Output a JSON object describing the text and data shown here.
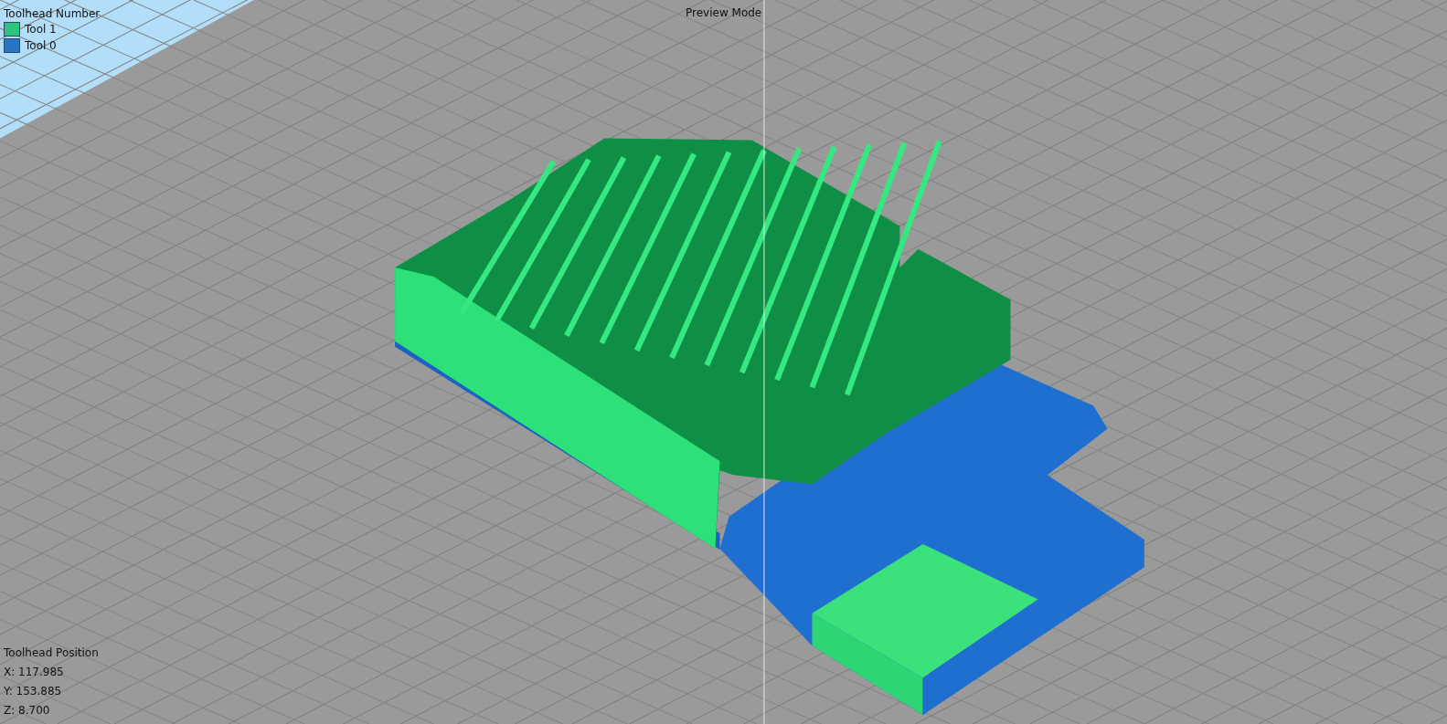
{
  "legend": {
    "title": "Toolhead Number",
    "items": [
      {
        "label": "Tool 1",
        "color": "#2ec47e"
      },
      {
        "label": "Tool 0",
        "color": "#2a74c6"
      }
    ]
  },
  "mode_label": "Preview Mode",
  "position": {
    "title": "Toolhead Position",
    "lines": [
      "X: 117.985",
      "Y: 153.885",
      "Z: 8.700"
    ]
  }
}
